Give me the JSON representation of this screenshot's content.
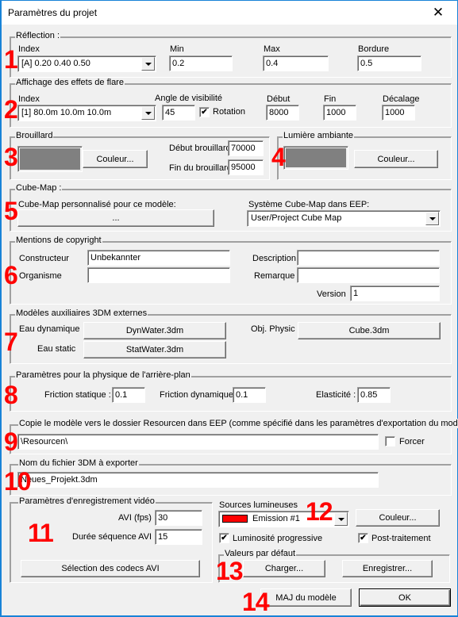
{
  "window": {
    "title": "Paramètres du projet",
    "close_icon": "close-icon"
  },
  "annotations": [
    "1",
    "2",
    "3",
    "4",
    "5",
    "6",
    "7",
    "8",
    "9",
    "10",
    "11",
    "12",
    "13",
    "14"
  ],
  "reflection": {
    "legend": "Réflection :",
    "index_label": "Index",
    "index_value": "[A] 0.20  0.40  0.50",
    "min_label": "Min",
    "min_value": "0.2",
    "max_label": "Max",
    "max_value": "0.4",
    "border_label": "Bordure",
    "border_value": "0.5"
  },
  "flare": {
    "legend": "Affichage des effets de flare",
    "index_label": "Index",
    "index_value": "[1] 80.0m  10.0m  10.0m",
    "angle_label": "Angle de visibilité",
    "angle_value": "45",
    "rotation_label": "Rotation",
    "rotation_checked": true,
    "check_glyph": "✔",
    "start_label": "Début",
    "start_value": "8000",
    "end_label": "Fin",
    "end_value": "1000",
    "offset_label": "Décalage",
    "offset_value": "1000"
  },
  "fog": {
    "legend": "Brouillard",
    "color_swatch": "#808080",
    "color_button": "Couleur...",
    "start_label": "Début brouillard",
    "start_value": "70000",
    "end_label": "Fin du brouillard",
    "end_value": "95000"
  },
  "ambient": {
    "legend": "Lumière ambiante",
    "color_swatch": "#808080",
    "color_button": "Couleur..."
  },
  "cubemap": {
    "legend": "Cube-Map :",
    "custom_label": "Cube-Map personnalisé pour ce modèle:",
    "custom_button": "...",
    "system_label": "Système Cube-Map dans EEP:",
    "system_value": "User/Project Cube Map"
  },
  "copyright": {
    "legend": "Mentions de copyright",
    "constructor_label": "Constructeur",
    "constructor_value": "Unbekannter",
    "organism_label": "Organisme",
    "organism_value": "",
    "description_label": "Description",
    "description_value": "",
    "remark_label": "Remarque",
    "remark_value": "",
    "version_label": "Version",
    "version_value": "1"
  },
  "aux_models": {
    "legend": "Modèles auxiliaires 3DM externes",
    "dyn_water_label": "Eau dynamique",
    "dyn_water_button": "DynWater.3dm",
    "stat_water_label": "Eau static",
    "stat_water_button": "StatWater.3dm",
    "physic_label": "Obj. Physic",
    "physic_button": "Cube.3dm"
  },
  "physics": {
    "legend": "Paramètres pour la physique de l'arrière-plan",
    "static_label": "Friction statique :",
    "static_value": "0.1",
    "dynamic_label": "Friction dynamique",
    "dynamic_value": "0.1",
    "elasticity_label": "Elasticité :",
    "elasticity_value": "0.85"
  },
  "resources": {
    "legend": "Copie le modèle vers le dossier Resourcen dans EEP (comme spécifié dans les paramètres d'exportation du modèle)",
    "path_value": "\\Resourcen\\",
    "force_label": "Forcer",
    "force_checked": false
  },
  "export_file": {
    "legend": "Nom du fichier 3DM à exporter",
    "file_value": "Neues_Projekt.3dm"
  },
  "video": {
    "legend": "Paramètres d'enregistrement vidéo",
    "fps_label": "AVI (fps)",
    "fps_value": "30",
    "duration_label": "Durée séquence AVI",
    "duration_value": "15",
    "codec_button": "Sélection des codecs AVI"
  },
  "lights": {
    "label": "Sources lumineuses",
    "selected_value": "Emission #1",
    "selected_color": "#ff0000",
    "color_button": "Couleur...",
    "progressive_label": "Luminosité progressive",
    "progressive_checked": true,
    "postprocess_label": "Post-traitement",
    "postprocess_checked": true
  },
  "defaults": {
    "legend": "Valeurs par défaut",
    "load_button": "Charger...",
    "save_button": "Enregistrer..."
  },
  "footer": {
    "update_button": "MAJ du modèle",
    "ok_button": "OK"
  }
}
